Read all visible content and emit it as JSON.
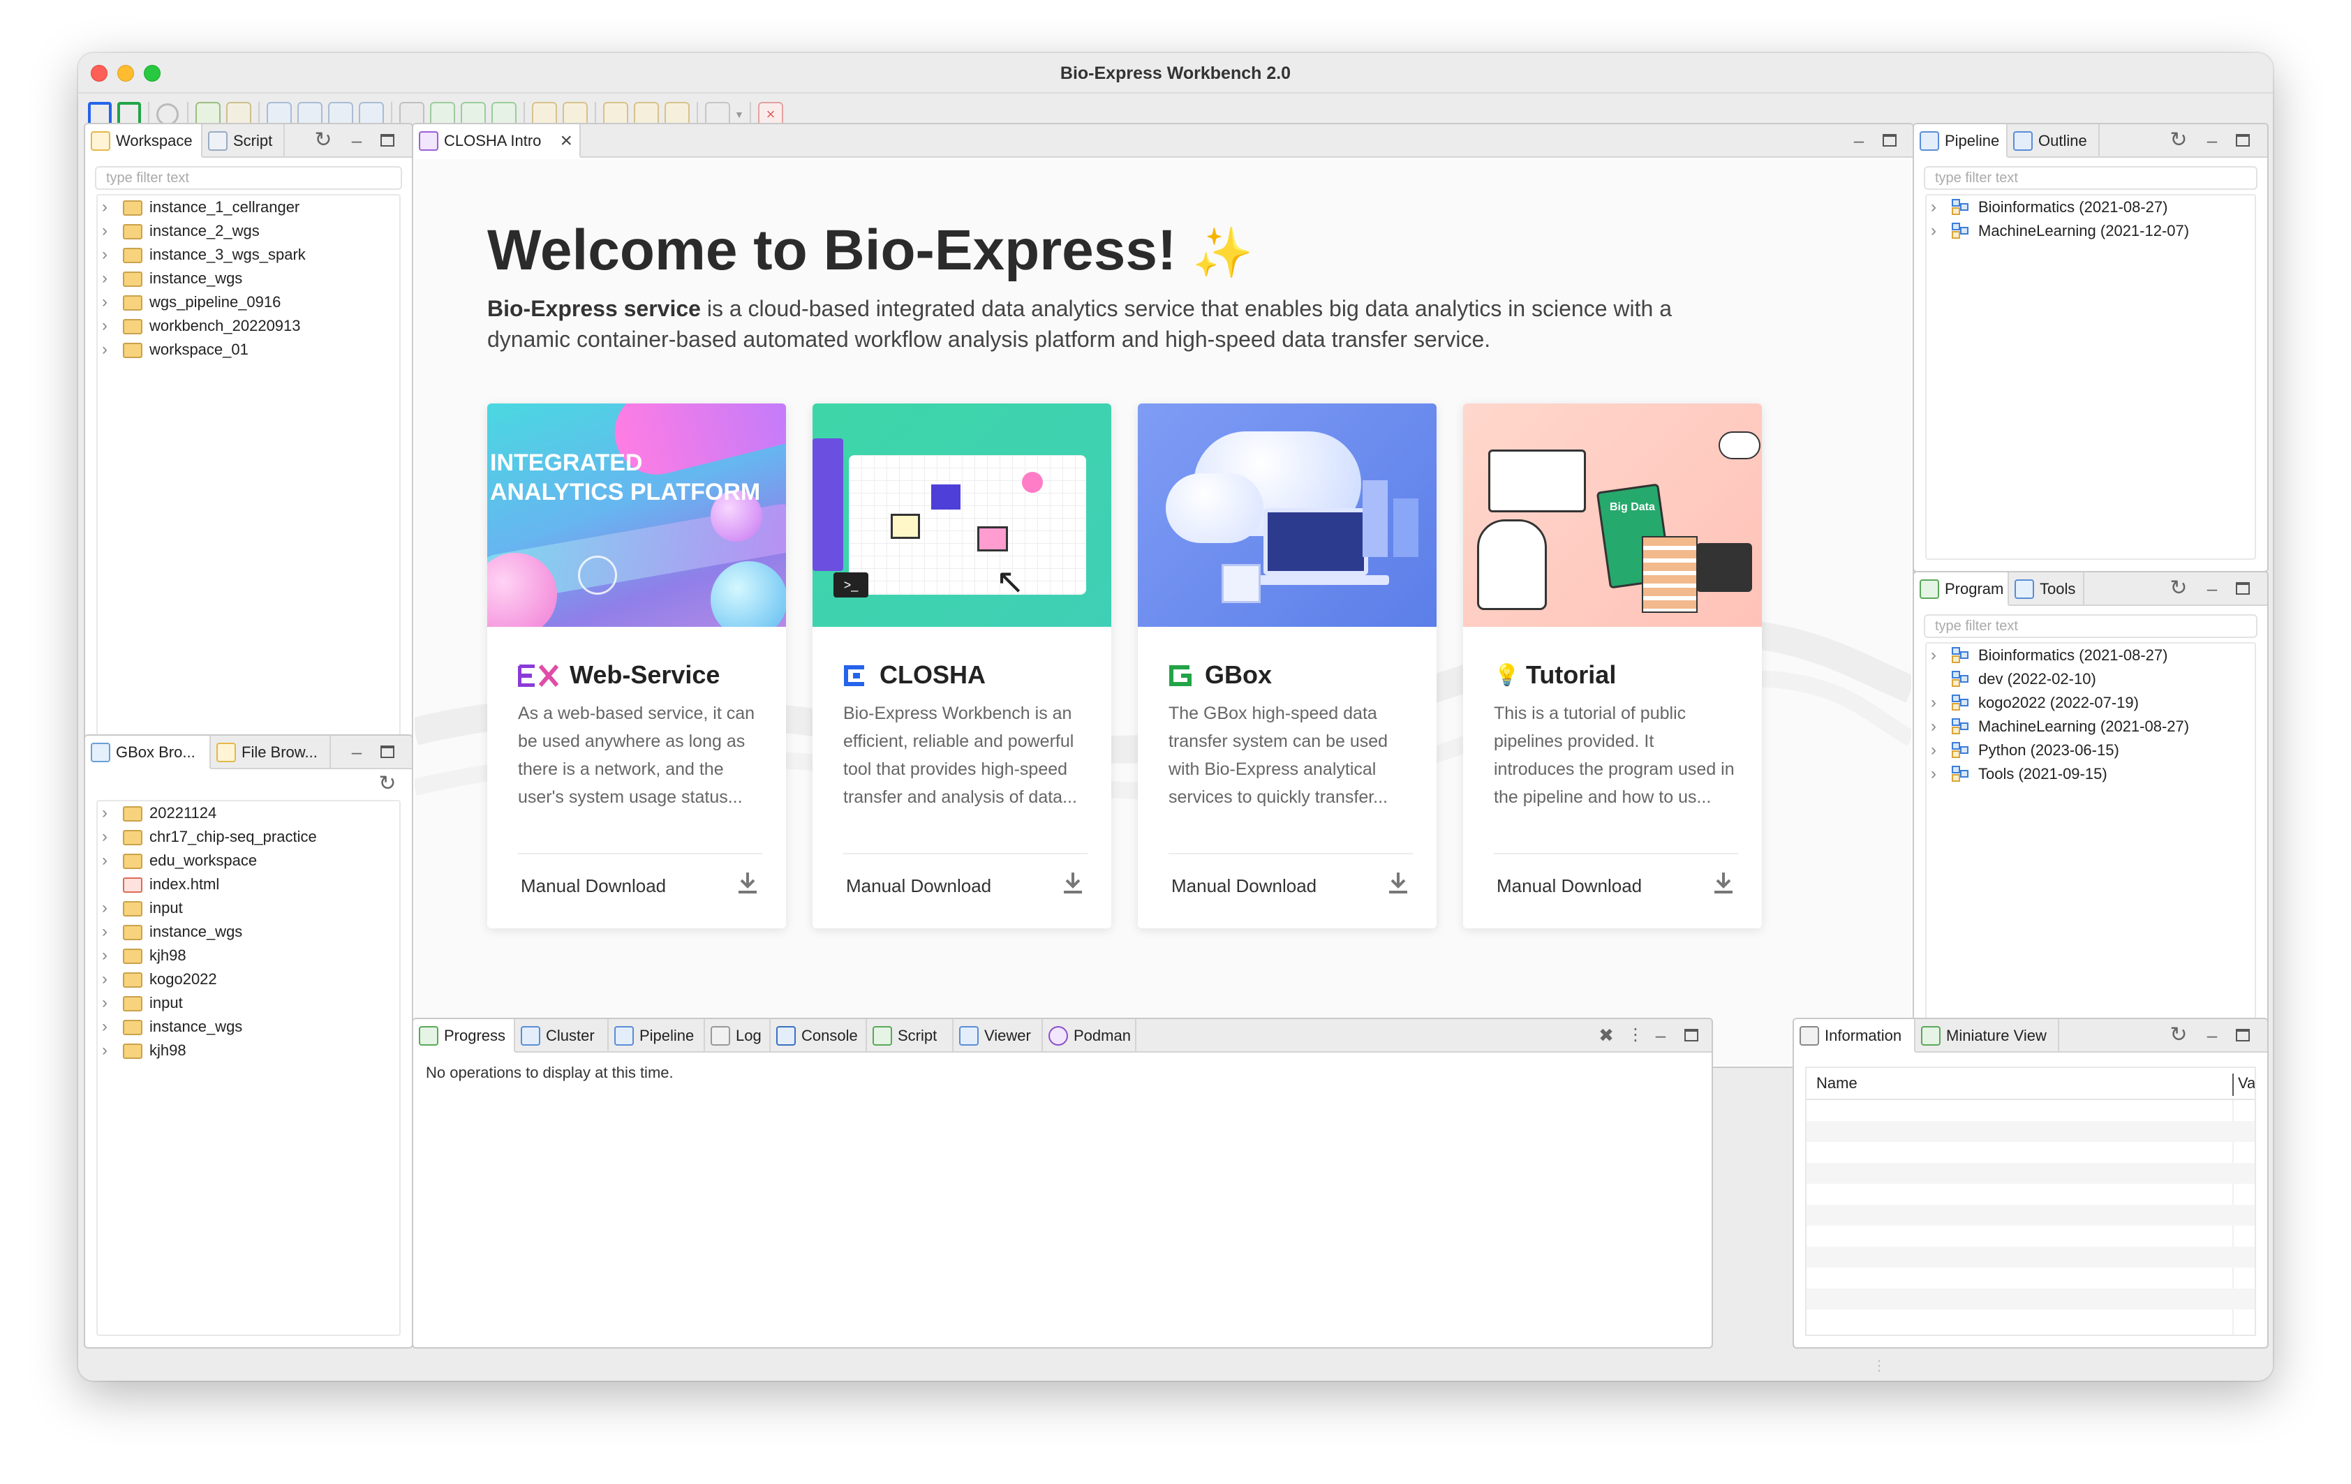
{
  "window": {
    "title": "Bio-Express Workbench 2.0"
  },
  "left_top": {
    "tabs": [
      {
        "label": "Workspace"
      },
      {
        "label": "Script"
      }
    ],
    "filter_placeholder": "type filter text",
    "items": [
      {
        "label": "instance_1_cellranger"
      },
      {
        "label": "instance_2_wgs"
      },
      {
        "label": "instance_3_wgs_spark"
      },
      {
        "label": "instance_wgs"
      },
      {
        "label": "wgs_pipeline_0916"
      },
      {
        "label": "workbench_20220913"
      },
      {
        "label": "workspace_01"
      }
    ]
  },
  "left_bottom": {
    "tabs": [
      {
        "label": "GBox Bro..."
      },
      {
        "label": "File Brow..."
      }
    ],
    "items": [
      {
        "label": "20221124",
        "kind": "folder"
      },
      {
        "label": "chr17_chip-seq_practice",
        "kind": "folder"
      },
      {
        "label": "edu_workspace",
        "kind": "folder"
      },
      {
        "label": "index.html",
        "kind": "html"
      },
      {
        "label": "input",
        "kind": "folder"
      },
      {
        "label": "instance_wgs",
        "kind": "folder"
      },
      {
        "label": "kjh98",
        "kind": "folder"
      },
      {
        "label": "kogo2022",
        "kind": "folder"
      },
      {
        "label": "input",
        "kind": "folder"
      },
      {
        "label": "instance_wgs",
        "kind": "folder"
      },
      {
        "label": "kjh98",
        "kind": "folder"
      }
    ]
  },
  "editor": {
    "tab_label": "CLOSHA Intro",
    "welcome_title": "Welcome to Bio-Express!",
    "sparkle": "✨",
    "desc_bold": "Bio-Express service",
    "desc_rest": " is a cloud-based integrated data analytics service that enables big data analytics in science with a dynamic container-based automated workflow analysis platform and high-speed data transfer service.",
    "cards": [
      {
        "title": "Web-Service",
        "banner_line1": "INTEGRATED",
        "banner_line2": "ANALYTICS PLATFORM",
        "desc": "As a web-based service, it can be used anywhere as long as there is a network, and the user's system usage status...",
        "download": "Manual Download",
        "color": "#8a3bd8"
      },
      {
        "title": "CLOSHA",
        "desc": "Bio-Express Workbench is an efficient, reliable and powerful tool that provides high-speed transfer and analysis of data...",
        "download": "Manual Download",
        "color": "#2563eb"
      },
      {
        "title": "GBox",
        "desc": "The GBox high-speed data transfer system can be used with Bio-Express analytical services to quickly transfer...",
        "download": "Manual Download",
        "color": "#22a447"
      },
      {
        "title": "Tutorial",
        "illus_text": "Big Data",
        "desc": "This is a tutorial of public pipelines provided. It introduces the program used in the pipeline and how to us...",
        "download": "Manual Download",
        "color": "#f2b705"
      }
    ]
  },
  "right_top": {
    "tabs": [
      {
        "label": "Pipeline"
      },
      {
        "label": "Outline"
      }
    ],
    "filter_placeholder": "type filter text",
    "items": [
      {
        "label": "Bioinformatics (2021-08-27)"
      },
      {
        "label": "MachineLearning (2021-12-07)"
      }
    ]
  },
  "right_mid": {
    "tabs": [
      {
        "label": "Program"
      },
      {
        "label": "Tools"
      }
    ],
    "filter_placeholder": "type filter text",
    "items": [
      {
        "label": "Bioinformatics (2021-08-27)",
        "expandable": true
      },
      {
        "label": "dev (2022-02-10)",
        "expandable": false
      },
      {
        "label": "kogo2022 (2022-07-19)",
        "expandable": true
      },
      {
        "label": "MachineLearning (2021-08-27)",
        "expandable": true
      },
      {
        "label": "Python (2023-06-15)",
        "expandable": true
      },
      {
        "label": "Tools (2021-09-15)",
        "expandable": true
      }
    ]
  },
  "bottom": {
    "tabs": [
      {
        "label": "Progress"
      },
      {
        "label": "Cluster"
      },
      {
        "label": "Pipeline"
      },
      {
        "label": "Log"
      },
      {
        "label": "Console"
      },
      {
        "label": "Script"
      },
      {
        "label": "Viewer"
      },
      {
        "label": "Podman"
      }
    ],
    "message": "No operations to display at this time."
  },
  "info": {
    "tabs": [
      {
        "label": "Information"
      },
      {
        "label": "Miniature View"
      }
    ],
    "col_name": "Name",
    "col_value": "Value"
  }
}
